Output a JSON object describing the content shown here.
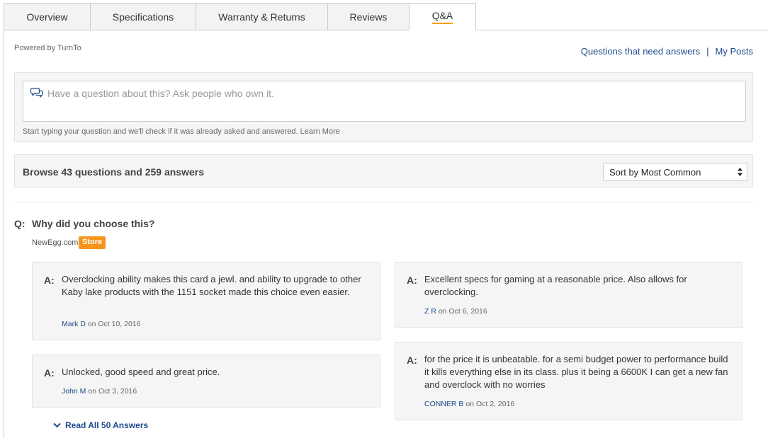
{
  "tabs": [
    {
      "label": "Overview"
    },
    {
      "label": "Specifications"
    },
    {
      "label": "Warranty & Returns"
    },
    {
      "label": "Reviews"
    },
    {
      "label": "Q&A"
    }
  ],
  "powered_by": "Powered by TurnTo",
  "top_links": {
    "questions_need_answers": "Questions that need answers",
    "separator": "|",
    "my_posts": "My Posts"
  },
  "ask": {
    "placeholder": "Have a question about this? Ask people who own it.",
    "hint": "Start typing your question and we'll check if it was already asked and answered.",
    "learn_more": "Learn More"
  },
  "browse": {
    "title": "Browse 43 questions and 259 answers",
    "sort_selected": "Sort by Most Common"
  },
  "question": {
    "label": "Q:",
    "text": "Why did you choose this?",
    "source": "NewEgg.com",
    "badge": "Store"
  },
  "answers": [
    {
      "label": "A:",
      "text": "Overclocking ability makes this card a jewl. and ability to upgrade to other Kaby lake products with the 1151 socket made this choice even easier.",
      "author": "Mark D",
      "date": "on Oct 10, 2016"
    },
    {
      "label": "A:",
      "text": "Unlocked, good speed and great price.",
      "author": "John M",
      "date": "on Oct 3, 2016"
    },
    {
      "label": "A:",
      "text": "Excellent specs for gaming at a reasonable price. Also allows for overclocking.",
      "author": "Z R",
      "date": "on Oct 6, 2016"
    },
    {
      "label": "A:",
      "text": "for the price it is unbeatable. for a semi budget power to performance build it kills everything else in its class. plus it being a 6600K I can get a new fan and overclock with no worries",
      "author": "CONNER B",
      "date": "on Oct 2, 2016"
    }
  ],
  "read_all": "Read All 50 Answers",
  "colors": {
    "link": "#1c4a8c",
    "accent": "#f7a11a",
    "badge": "#f7941d"
  },
  "icons": [
    "speech-bubbles-icon",
    "select-arrows-icon",
    "chevron-down-icon"
  ]
}
